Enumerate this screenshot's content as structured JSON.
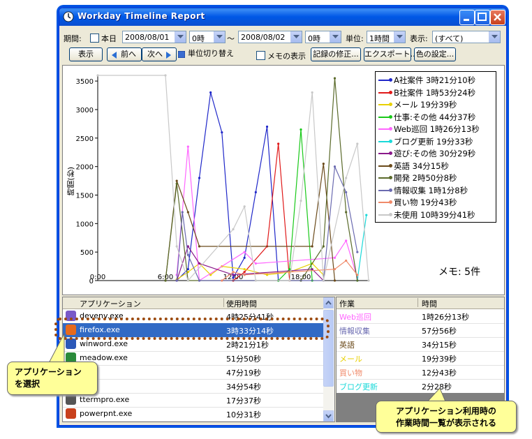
{
  "window": {
    "title": "Workday Timeline Report"
  },
  "toolbar": {
    "period_label": "期間:",
    "today_label": "本日",
    "start_date": "2008/08/01",
    "start_hour": "0時",
    "tilde": "〜",
    "end_date": "2008/08/02",
    "end_hour": "0時",
    "unit_label": "単位:",
    "unit_value": "1時間",
    "display_label": "表示:",
    "display_value": "(すべて)",
    "show_button": "表示",
    "prev_button": "前へ",
    "next_button": "次へ",
    "unit_switch_button": "単位切り替え",
    "memo_show_label": "メモの表示",
    "edit_record_button": "記録の修正...",
    "export_button": "エクスポート...",
    "color_button": "色の設定..."
  },
  "chart_data": {
    "type": "line",
    "ylabel": "時間(秒)",
    "ylim": [
      0,
      3600
    ],
    "yticks": [
      0,
      500,
      1000,
      1500,
      2000,
      2500,
      3000,
      3500
    ],
    "xticks": [
      "0:00",
      "6:00",
      "12:00",
      "18:00"
    ],
    "xlim": [
      0,
      24
    ],
    "series": [
      {
        "name": "A社案件 3時21分10秒",
        "color": "#1f27c9",
        "points": [
          [
            7,
            0
          ],
          [
            8,
            200
          ],
          [
            9,
            1800
          ],
          [
            10,
            3300
          ],
          [
            11,
            2600
          ],
          [
            12,
            50
          ],
          [
            13,
            400
          ],
          [
            14,
            1550
          ],
          [
            15,
            2700
          ],
          [
            16,
            0
          ]
        ]
      },
      {
        "name": "B社案件 1時53分24秒",
        "color": "#e01919",
        "points": [
          [
            12,
            0
          ],
          [
            13,
            150
          ],
          [
            15,
            600
          ],
          [
            16,
            2400
          ],
          [
            17,
            0
          ]
        ]
      },
      {
        "name": "メール 19分39秒",
        "color": "#e8d000",
        "points": [
          [
            7,
            20
          ],
          [
            8,
            150
          ],
          [
            9,
            300
          ],
          [
            10,
            100
          ],
          [
            11,
            250
          ],
          [
            13,
            200
          ],
          [
            15,
            100
          ],
          [
            17,
            150
          ],
          [
            19,
            300
          ],
          [
            20,
            100
          ]
        ]
      },
      {
        "name": "仕事:その他 44分37秒",
        "color": "#19c919",
        "points": [
          [
            16,
            0
          ],
          [
            17,
            200
          ],
          [
            18,
            2650
          ],
          [
            19,
            0
          ]
        ]
      },
      {
        "name": "Web巡回 1時26分13秒",
        "color": "#ff66ff",
        "points": [
          [
            7,
            100
          ],
          [
            8,
            2350
          ],
          [
            9,
            0
          ],
          [
            13,
            500
          ],
          [
            14,
            300
          ],
          [
            21,
            400
          ],
          [
            22,
            700
          ],
          [
            23,
            50
          ]
        ]
      },
      {
        "name": "ブログ更新 19分33秒",
        "color": "#19d9d9",
        "points": [
          [
            23,
            0
          ],
          [
            23.8,
            1150
          ]
        ]
      },
      {
        "name": "遊び:その他 30分29秒",
        "color": "#8a1a8a",
        "points": [
          [
            7,
            0
          ],
          [
            8,
            600
          ],
          [
            9,
            300
          ],
          [
            12,
            100
          ],
          [
            19,
            200
          ],
          [
            20,
            0
          ]
        ]
      },
      {
        "name": "英語 34分15秒",
        "color": "#6b4a1a",
        "points": [
          [
            6,
            0
          ],
          [
            7,
            1750
          ],
          [
            8,
            1200
          ],
          [
            9,
            600
          ],
          [
            19,
            600
          ],
          [
            20,
            2050
          ],
          [
            21,
            0
          ]
        ]
      },
      {
        "name": "開発 2時50分8秒",
        "color": "#5a6a2a",
        "points": [
          [
            6,
            0
          ],
          [
            7,
            1700
          ],
          [
            8,
            0
          ],
          [
            18,
            0
          ],
          [
            20,
            600
          ],
          [
            21,
            3550
          ],
          [
            22,
            1200
          ],
          [
            23,
            0
          ]
        ]
      },
      {
        "name": "情報収集 1時1分8秒",
        "color": "#6a6ab0",
        "points": [
          [
            7,
            0
          ],
          [
            7.5,
            1200
          ],
          [
            8,
            450
          ],
          [
            9,
            0
          ],
          [
            20,
            0
          ],
          [
            21,
            2000
          ],
          [
            22,
            1550
          ],
          [
            23,
            500
          ]
        ]
      },
      {
        "name": "買い物 19分43秒",
        "color": "#f08a6a",
        "points": [
          [
            11,
            0
          ],
          [
            12,
            150
          ],
          [
            13,
            100
          ],
          [
            21,
            200
          ],
          [
            22,
            350
          ],
          [
            23,
            100
          ]
        ]
      },
      {
        "name": "未使用 10時39分41秒",
        "color": "#c8c8c8",
        "points": [
          [
            0,
            3600
          ],
          [
            6,
            3600
          ],
          [
            7,
            600
          ],
          [
            8,
            0
          ],
          [
            12,
            900
          ],
          [
            13,
            1300
          ],
          [
            14,
            0
          ],
          [
            17,
            0
          ],
          [
            18,
            1400
          ],
          [
            19,
            3300
          ],
          [
            20,
            0
          ],
          [
            22,
            1800
          ],
          [
            23,
            2400
          ],
          [
            24,
            0
          ]
        ]
      }
    ]
  },
  "memo": "メモ: 5件",
  "app_table": {
    "col_app": "アプリケーション",
    "col_time": "使用時間",
    "rows": [
      {
        "name": "devenv.exe",
        "time": "4時25分41秒",
        "icon": "devenv-icon"
      },
      {
        "name": "firefox.exe",
        "time": "3時33分14秒",
        "icon": "firefox-icon",
        "selected": true
      },
      {
        "name": "winword.exe",
        "time": "2時21分1秒",
        "icon": "word-icon"
      },
      {
        "name": "meadow.exe",
        "time": "51分50秒",
        "icon": "meadow-icon"
      },
      {
        "name": "e",
        "time": "47分19秒",
        "icon": "app-icon"
      },
      {
        "name": "xe",
        "time": "34分54秒",
        "icon": "app-icon"
      },
      {
        "name": "ttermpro.exe",
        "time": "17分37秒",
        "icon": "terminal-icon"
      },
      {
        "name": "powerpnt.exe",
        "time": "10分31秒",
        "icon": "powerpoint-icon"
      }
    ]
  },
  "task_table": {
    "col_task": "作業",
    "col_time": "時間",
    "rows": [
      {
        "name": "Web巡回",
        "time": "1時26分13秒",
        "color": "#ff66ff"
      },
      {
        "name": "情報収集",
        "time": "57分56秒",
        "color": "#6a6ab0"
      },
      {
        "name": "英語",
        "time": "34分15秒",
        "color": "#6b4a1a"
      },
      {
        "name": "メール",
        "time": "19分39秒",
        "color": "#e8d000"
      },
      {
        "name": "買い物",
        "time": "12分43秒",
        "color": "#f08a6a"
      },
      {
        "name": "ブログ更新",
        "time": "2分28秒",
        "color": "#19d9d9"
      }
    ]
  },
  "callouts": {
    "left": "アプリケーション\nを選択",
    "right": "アプリケーション利用時の\n作業時間一覧が表示される"
  }
}
